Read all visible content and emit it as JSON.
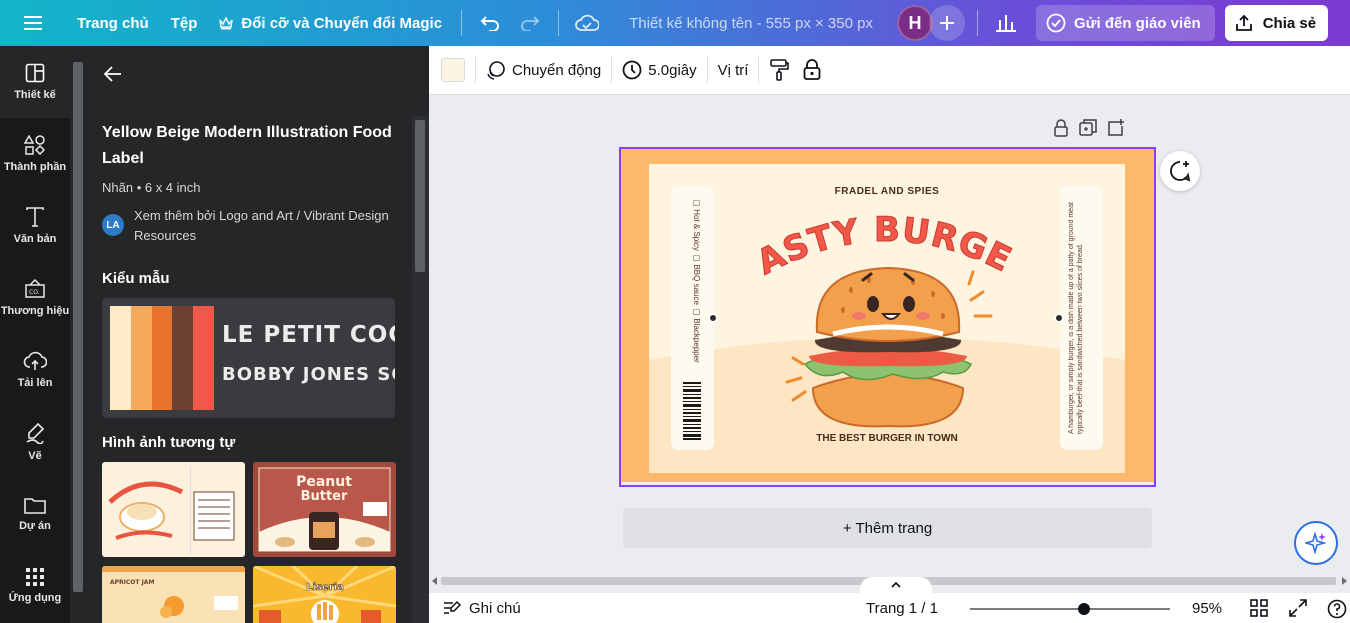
{
  "topbar": {
    "home": "Trang chủ",
    "file": "Tệp",
    "resize": "Đổi cỡ và Chuyển đổi Magic",
    "doc_title": "Thiết kế không tên - 555 px × 350 px",
    "avatar_initial": "H",
    "send_teacher": "Gửi đến giáo viên",
    "share": "Chia sẻ"
  },
  "rail": {
    "items": [
      {
        "label": "Thiết kế"
      },
      {
        "label": "Thành phần"
      },
      {
        "label": "Văn bản"
      },
      {
        "label": "Thương hiệu"
      },
      {
        "label": "Tải lên"
      },
      {
        "label": "Vẽ"
      },
      {
        "label": "Dự án"
      },
      {
        "label": "Ứng dụng"
      }
    ]
  },
  "panel": {
    "title": "Yellow Beige Modern Illustration Food Label",
    "meta": "Nhãn • 6 x 4 inch",
    "author_initials": "LA",
    "author": "Xem thêm bởi Logo and Art / Vibrant Design Resources",
    "styles_heading": "Kiểu mẫu",
    "style_font1": "LE PETIT COCHON",
    "style_font2": "BOBBY JONES SOFT",
    "style_colors": [
      "#fdebc8",
      "#f5a95b",
      "#e8732f",
      "#6b4232",
      "#f2584a"
    ],
    "similar_heading": "Hình ảnh tương tự"
  },
  "toolbar": {
    "color": "#fdf5e3",
    "animate": "Chuyển động",
    "duration": "5.0giây",
    "position": "Vị trí"
  },
  "design": {
    "brand": "FRADEL AND SPIES",
    "headline": "TASTY BURGER",
    "tagline": "THE BEST BURGER IN TOWN",
    "options": "▢ Hot & Spicy  ▢ BBQ sauce  ▢ Blackpepper",
    "description": "A hamburger, or simply burger, is a dish made up of a patty of ground meat typically beef-that is sandwiched between two slices of bread."
  },
  "canvas": {
    "add_page": "+ Thêm trang"
  },
  "bottombar": {
    "notes": "Ghi chú",
    "page": "Trang 1 / 1",
    "zoom": "95%",
    "zoom_level": 0.57
  }
}
